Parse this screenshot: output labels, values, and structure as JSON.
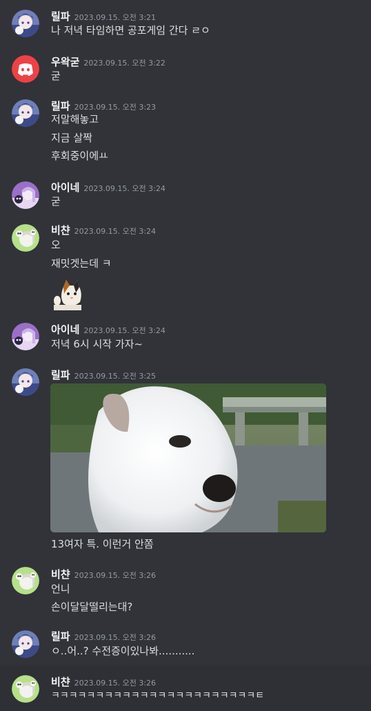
{
  "colors": {
    "background": "#313338",
    "name": "#f2f3f5",
    "timestamp": "#949ba4",
    "text": "#dbdee1",
    "discord_red": "#ed4245"
  },
  "messages": [
    {
      "author": "릴파",
      "time": "2023.09.15. 오전 3:21",
      "avatar": "lilpa-avatar",
      "lines": [
        "나 저녁 타임하면 공포게임 간다 ㄹㅇ"
      ]
    },
    {
      "author": "우왁굳",
      "time": "2023.09.15. 오전 3:22",
      "avatar": "discord-logo-icon",
      "lines": [
        "굳"
      ]
    },
    {
      "author": "릴파",
      "time": "2023.09.15. 오전 3:23",
      "avatar": "lilpa-avatar",
      "lines": [
        "저말해놓고",
        "지금 살짝",
        "후회중이에ㅛ"
      ]
    },
    {
      "author": "아이네",
      "time": "2023.09.15. 오전 3:24",
      "avatar": "ine-avatar",
      "lines": [
        "굳"
      ]
    },
    {
      "author": "비챤",
      "time": "2023.09.15. 오전 3:24",
      "avatar": "viichan-avatar",
      "lines": [
        "오",
        "재밋겟는데 ㅋ"
      ],
      "attachment": "cat-sticker-image"
    },
    {
      "author": "아이네",
      "time": "2023.09.15. 오전 3:24",
      "avatar": "ine-avatar",
      "lines": [
        "저녁 6시 시작 가자~"
      ]
    },
    {
      "author": "릴파",
      "time": "2023.09.15. 오전 3:25",
      "avatar": "lilpa-avatar",
      "attachment": "puppy-gif",
      "lines": [
        "13여자 특. 이런거 안쫌"
      ]
    },
    {
      "author": "비챤",
      "time": "2023.09.15. 오전 3:26",
      "avatar": "viichan-avatar",
      "lines": [
        "언니",
        "손이달달떨리는대?"
      ]
    },
    {
      "author": "릴파",
      "time": "2023.09.15. 오전 3:26",
      "avatar": "lilpa-avatar",
      "lines": [
        "ㅇ..어..? 수전증이있나봐..........."
      ]
    },
    {
      "author": "비챤",
      "time": "2023.09.15. 오전 3:26",
      "avatar": "viichan-avatar",
      "lines": [
        "ㅋㅋㅋㅋㅋㅋㅋㅋㅋㅋㅋㅋㅋㅋㅋㅋㅋㅋㅋㅋㅋㅋㅋㅌ"
      ]
    }
  ]
}
